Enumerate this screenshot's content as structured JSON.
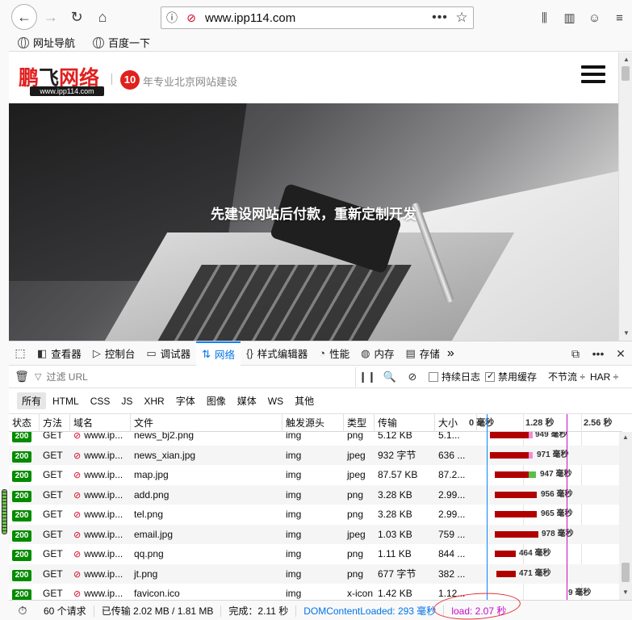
{
  "browser": {
    "url": "www.ipp114.com",
    "bookmarks": [
      "网址导航",
      "百度一下"
    ]
  },
  "site": {
    "logo_cn_part1": "鹏",
    "logo_cn_part2": "飞",
    "logo_cn_part3": "网络",
    "logo_domain": "www.ipp114.com",
    "years_badge": "10",
    "tagline": "年专业北京网站建设",
    "hero_title": "先建设网站后付款，重新定制开发"
  },
  "devtools": {
    "tabs": [
      {
        "icon": "◧",
        "label": "查看器"
      },
      {
        "icon": "▷",
        "label": "控制台"
      },
      {
        "icon": "▭",
        "label": "调试器"
      },
      {
        "icon": "⇅",
        "label": "网络"
      },
      {
        "icon": "{}",
        "label": "样式编辑器"
      },
      {
        "icon": "◔",
        "label": "性能"
      },
      {
        "icon": "◍",
        "label": "内存"
      },
      {
        "icon": "▤",
        "label": "存储"
      }
    ],
    "active_tab": "网络",
    "filter_placeholder": "过滤 URL",
    "persist_logs_label": "持续日志",
    "persist_logs_checked": false,
    "disable_cache_label": "禁用缓存",
    "disable_cache_checked": true,
    "throttle_label": "不节流 ÷",
    "har_label": "HAR ÷",
    "type_filters": [
      "所有",
      "HTML",
      "CSS",
      "JS",
      "XHR",
      "字体",
      "图像",
      "媒体",
      "WS",
      "其他"
    ],
    "active_type": "所有",
    "columns": {
      "status": "状态",
      "method": "方法",
      "domain": "域名",
      "file": "文件",
      "cause": "触发源头",
      "type": "类型",
      "transferred": "传输",
      "size": "大小",
      "tick0": "0 毫秒",
      "tick1": "1.28 秒",
      "tick2": "2.56 秒"
    },
    "rows": [
      {
        "status": "200",
        "method": "GET",
        "domain": "www.ip...",
        "file": "news_bj2.png",
        "cause": "img",
        "type": "png",
        "transferred": "5.12 KB",
        "size": "5.1...",
        "timing": "949 毫秒"
      },
      {
        "status": "200",
        "method": "GET",
        "domain": "www.ip...",
        "file": "news_xian.jpg",
        "cause": "img",
        "type": "jpeg",
        "transferred": "932 字节",
        "size": "636 ...",
        "timing": "971 毫秒"
      },
      {
        "status": "200",
        "method": "GET",
        "domain": "www.ip...",
        "file": "map.jpg",
        "cause": "img",
        "type": "jpeg",
        "transferred": "87.57 KB",
        "size": "87.2...",
        "timing": "947 毫秒"
      },
      {
        "status": "200",
        "method": "GET",
        "domain": "www.ip...",
        "file": "add.png",
        "cause": "img",
        "type": "png",
        "transferred": "3.28 KB",
        "size": "2.99...",
        "timing": "956 毫秒"
      },
      {
        "status": "200",
        "method": "GET",
        "domain": "www.ip...",
        "file": "tel.png",
        "cause": "img",
        "type": "png",
        "transferred": "3.28 KB",
        "size": "2.99...",
        "timing": "965 毫秒"
      },
      {
        "status": "200",
        "method": "GET",
        "domain": "www.ip...",
        "file": "email.jpg",
        "cause": "img",
        "type": "jpeg",
        "transferred": "1.03 KB",
        "size": "759 ...",
        "timing": "978 毫秒"
      },
      {
        "status": "200",
        "method": "GET",
        "domain": "www.ip...",
        "file": "qq.png",
        "cause": "img",
        "type": "png",
        "transferred": "1.11 KB",
        "size": "844 ...",
        "timing": "464 毫秒"
      },
      {
        "status": "200",
        "method": "GET",
        "domain": "www.ip...",
        "file": "jt.png",
        "cause": "img",
        "type": "png",
        "transferred": "677 字节",
        "size": "382 ...",
        "timing": "471 毫秒"
      },
      {
        "status": "200",
        "method": "GET",
        "domain": "www.ip...",
        "file": "favicon.ico",
        "cause": "img",
        "type": "x-icon",
        "transferred": "1.42 KB",
        "size": "1.12...",
        "timing": "9 毫秒"
      }
    ],
    "summary": {
      "requests": "60 个请求",
      "transferred": "已传输 2.02 MB / 1.81 MB",
      "finish": "完成：2.11 秒",
      "dom_content_loaded": "DOMContentLoaded: 293 毫秒",
      "load": "load: 2.07 秒"
    }
  },
  "colors": {
    "accent": "#0a84ff",
    "status_ok": "#058b00",
    "waterfall_bar": "#b10000",
    "load_line": "#c80cc8",
    "annotation": "#e43030"
  }
}
